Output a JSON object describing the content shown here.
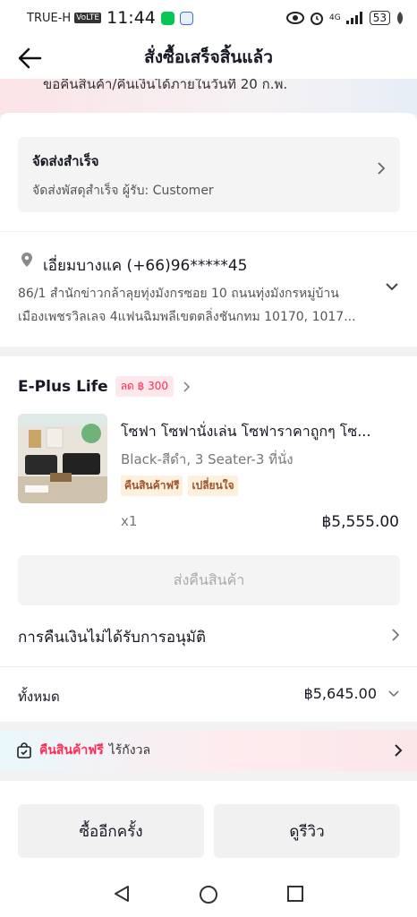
{
  "status_bar": {
    "carrier": "TRUE-H",
    "volte": "VoLTE",
    "time": "11:44",
    "network": "4G",
    "battery": "53"
  },
  "header": {
    "title": "สั่งซื้อเสร็จสิ้นแล้ว"
  },
  "banner": {
    "text": "ขอคืนสินค้า/คืนเงินได้ภายในวันที่ 20 ก.พ."
  },
  "shipping": {
    "title": "จัดส่งสำเร็จ",
    "detail": "จัดส่งพัสดุสำเร็จ ผู้รับ: Customer"
  },
  "address": {
    "name_phone": "เอี่ยมบางแค (+66)96*****45",
    "line1": "86/1 สำนักข่าวกล้าลุยทุ่งมังกรซอย 10 ถนนทุ่งมังกรหมู่บ้าน",
    "line2": "เมืองเพชรวิลเลจ 4แฟนฉิมพลีเขตตลิ่งชันกทม 10170, 1017..."
  },
  "order": {
    "shop_name": "E-Plus Life",
    "discount_badge": "ลด ฿ 300",
    "product": {
      "title": "โซฟา โซฟานั่งเล่น โซฟาราคาถูกๆ โซ...",
      "variant": "Black-สีดำ, 3 Seater-3 ที่นั่ง",
      "tags": [
        "คืนสินค้าฟรี",
        "เปลี่ยนใจ"
      ],
      "qty": "x1",
      "price": "฿5,555.00"
    },
    "return_button": "ส่งคืนสินค้า",
    "refund_status": "การคืนเงินไม่ได้รับการอนุมัติ",
    "total_label": "ทั้งหมด",
    "total_amount": "฿5,645.00"
  },
  "free_return": {
    "highlight": "คืนสินค้าฟรี",
    "text": "ไร้กังวล"
  },
  "actions": {
    "buy_again": "ซื้ออีกครั้ง",
    "review": "ดูรีวิว"
  },
  "colors": {
    "accent": "#fe2c55",
    "tag_text": "#a0522d",
    "tag_bg": "#fdf0dc"
  }
}
